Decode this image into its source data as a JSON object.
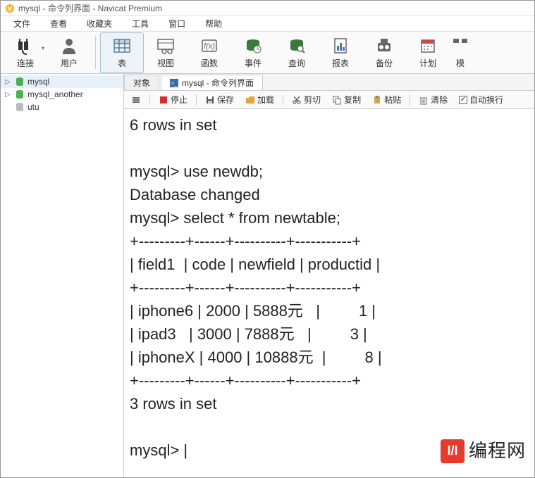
{
  "window": {
    "title": "mysql - 命令列界面 - Navicat Premium"
  },
  "menu": {
    "file": "文件",
    "view": "查看",
    "fav": "收藏夹",
    "tools": "工具",
    "window": "窗口",
    "help": "帮助"
  },
  "toolbar": {
    "conn": "连接",
    "user": "用户",
    "table": "表",
    "view": "视图",
    "func": "函数",
    "event": "事件",
    "query": "查询",
    "report": "报表",
    "backup": "备份",
    "plan": "计划",
    "model": "模"
  },
  "tree": {
    "items": [
      {
        "label": "mysql",
        "open": false
      },
      {
        "label": "mysql_another",
        "open": false
      },
      {
        "label": "utu",
        "open": false
      }
    ]
  },
  "tabs": {
    "objects": "对象",
    "console": "mysql - 命令列界面"
  },
  "actions": {
    "stop": "停止",
    "save": "保存",
    "load": "加载",
    "cut": "剪切",
    "copy": "复制",
    "paste": "粘贴",
    "clear": "清除",
    "wrap": "自动换行"
  },
  "console_text": "6 rows in set\n\nmysql> use newdb;\nDatabase changed\nmysql> select * from newtable;\n+---------+------+----------+-----------+\n| field1  | code | newfield | productid |\n+---------+------+----------+-----------+\n| iphone6 | 2000 | 5888元   |         1 |\n| ipad3   | 3000 | 7888元   |         3 |\n| iphoneX | 4000 | 10888元  |         8 |\n+---------+------+----------+-----------+\n3 rows in set\n\nmysql> |",
  "watermark": {
    "logo": "I/I",
    "text": "编程网"
  }
}
